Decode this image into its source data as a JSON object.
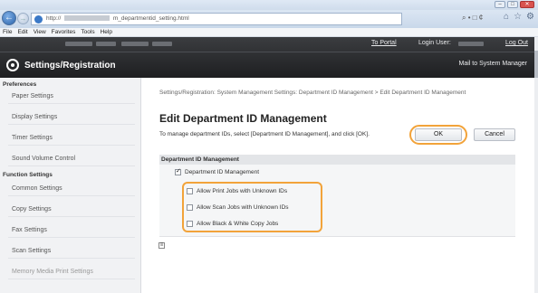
{
  "browser": {
    "url_prefix": "http://",
    "url_suffix": "m_departmentid_setting.html",
    "tools": "⌕ • □ ¢",
    "controls": [
      "–",
      "□",
      "✕"
    ]
  },
  "menu": [
    "File",
    "Edit",
    "View",
    "Favorites",
    "Tools",
    "Help"
  ],
  "header": {
    "to_portal": "To Portal",
    "login_label": "Login User:",
    "logout": "Log Out",
    "app_title": "Settings/Registration",
    "mail_link": "Mail to System Manager"
  },
  "sidebar": {
    "preferences_heading": "Preferences",
    "preferences": [
      "Paper Settings",
      "Display Settings",
      "Timer Settings",
      "Sound Volume Control"
    ],
    "function_heading": "Function Settings",
    "functions": [
      "Common Settings",
      "Copy Settings",
      "Fax Settings",
      "Scan Settings",
      "Memory Media Print Settings"
    ]
  },
  "main": {
    "breadcrumb": "Settings/Registration: System Management Settings: Department ID Management > Edit Department ID Management",
    "title": "Edit Department ID Management",
    "instruction": "To manage department IDs, select [Department ID Management], and click [OK].",
    "ok_label": "OK",
    "cancel_label": "Cancel",
    "section_heading": "Department ID Management",
    "main_checkbox": {
      "label": "Department ID Management",
      "checked": true
    },
    "options": [
      {
        "label": "Allow Print Jobs with Unknown IDs",
        "checked": false
      },
      {
        "label": "Allow Scan Jobs with Unknown IDs",
        "checked": false
      },
      {
        "label": "Allow Black & White Copy Jobs",
        "checked": false
      }
    ],
    "collapse_glyph": "≡"
  },
  "colors": {
    "highlight": "#f2a33a",
    "header_bg": "#2c2e31"
  }
}
